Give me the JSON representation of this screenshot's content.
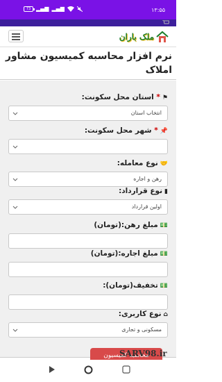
{
  "status_bar": {
    "time": "۱۳:۵۵",
    "battery": "73",
    "icons": [
      "battery-icon",
      "signal-icon",
      "signal-icon",
      "wifi-icon",
      "mute-icon"
    ]
  },
  "header": {
    "logo_text": "ملک باران",
    "menu_icon": "hamburger-icon"
  },
  "page_title": "نرم افزار محاسبه کمیسیون مشاور املاک",
  "form": {
    "fields": [
      {
        "label": "استان محل سکونت:",
        "required": true,
        "icon": "flag-icon",
        "type": "select",
        "value": "انتخاب استان"
      },
      {
        "label": "شهر محل سکونت:",
        "required": true,
        "icon": "pin-icon",
        "type": "select",
        "value": ""
      },
      {
        "label": "نوع معامله:",
        "required": false,
        "icon": "handshake-icon",
        "type": "select",
        "value": "رهن و اجاره"
      },
      {
        "label": "نوع قرارداد:",
        "required": false,
        "icon": "document-icon",
        "type": "select",
        "value": "اولین قرارداد"
      },
      {
        "label": "مبلغ رهن:(تومان)",
        "required": false,
        "icon": "money-icon",
        "type": "input",
        "value": ""
      },
      {
        "label": "مبلغ اجاره:(تومان)",
        "required": false,
        "icon": "money-icon",
        "type": "input",
        "value": ""
      },
      {
        "label": "تخفیف(تومان):",
        "required": false,
        "icon": "money-icon",
        "type": "input",
        "value": ""
      },
      {
        "label": "نوع کاربری:",
        "required": false,
        "icon": "home-icon",
        "type": "select",
        "value": "مسکونی و تجاری"
      }
    ],
    "submit_label": "محاسبه کمیسیون"
  },
  "watermark": "SARV98.ir",
  "system_nav": [
    "back-icon",
    "home-circle-icon",
    "recents-icon"
  ]
}
